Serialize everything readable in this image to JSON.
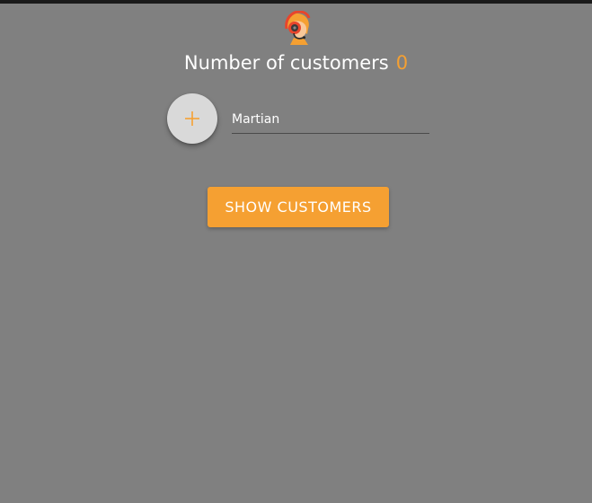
{
  "header": {
    "logo_icon": "customer-support-agent-icon",
    "title": "Number of customers",
    "count": "0"
  },
  "form": {
    "add_button_icon": "plus-icon",
    "name_value": "Martian",
    "name_placeholder": ""
  },
  "actions": {
    "show_customers_label": "SHOW CUSTOMERS"
  },
  "colors": {
    "background": "#808080",
    "accent": "#f5a032",
    "fab": "#d9d9d9",
    "top_bar": "#1a1a1a"
  }
}
